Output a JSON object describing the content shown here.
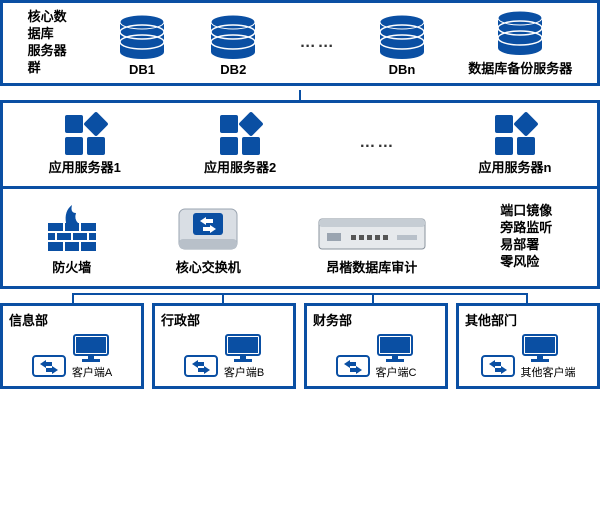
{
  "tier1": {
    "group_label": "核心数据库\n服务器群",
    "db1": "DB1",
    "db2": "DB2",
    "dbn": "DBn",
    "backup": "数据库备份服务器"
  },
  "tier2": {
    "app1": "应用服务器1",
    "app2": "应用服务器2",
    "appn": "应用服务器n"
  },
  "tier3": {
    "firewall": "防火墙",
    "switch": "核心交换机",
    "audit": "昂楷数据库审计",
    "note": "端口镜像\n旁路监听\n易部署\n零风险"
  },
  "depts": [
    {
      "name": "信息部",
      "client": "客户端A"
    },
    {
      "name": "行政部",
      "client": "客户端B"
    },
    {
      "name": "财务部",
      "client": "客户端C"
    },
    {
      "name": "其他部门",
      "client": "其他客户端"
    }
  ]
}
